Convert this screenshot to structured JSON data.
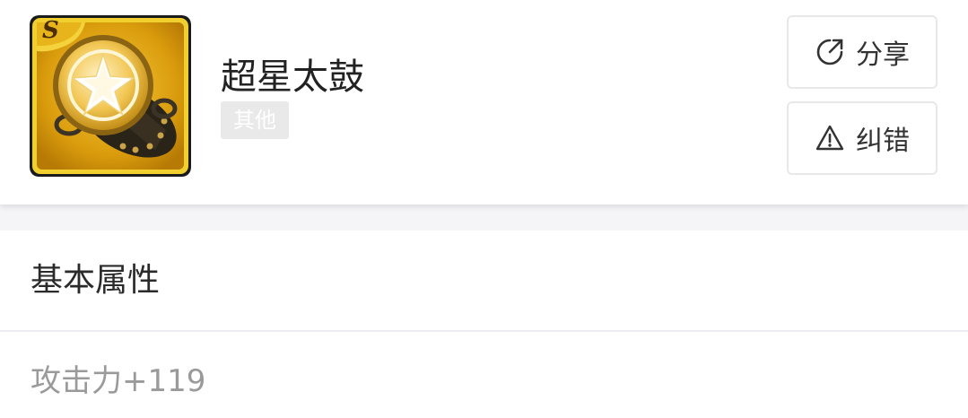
{
  "item": {
    "name": "超星太鼓",
    "category_tag": "其他",
    "icon": "drum-item-icon",
    "rank_badge": "S",
    "colors": {
      "icon_background": "#d9a30f",
      "icon_border": "#f2cf3b",
      "tag_background": "#e9e9e9"
    }
  },
  "actions": {
    "share": {
      "label": "分享",
      "icon": "share-icon"
    },
    "report": {
      "label": "纠错",
      "icon": "warning-icon"
    }
  },
  "section": {
    "title": "基本属性",
    "attributes": [
      "攻击力+119"
    ]
  }
}
